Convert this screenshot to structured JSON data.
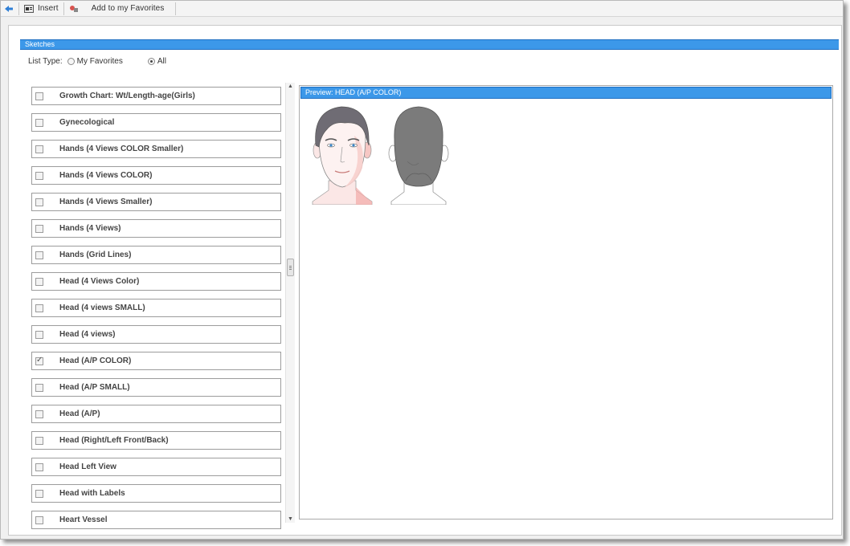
{
  "toolbar": {
    "back_icon": "back-arrow-icon",
    "insert_label": "Insert",
    "favorites_label": "Add to my Favorites"
  },
  "panel": {
    "title": "Sketches"
  },
  "list_type": {
    "label": "List Type:",
    "options": [
      {
        "label": "My Favorites",
        "selected": false
      },
      {
        "label": "All",
        "selected": true
      }
    ]
  },
  "items": [
    {
      "label": "Growth Chart: Wt/Length-age(Girls)",
      "checked": false
    },
    {
      "label": "Gynecological",
      "checked": false
    },
    {
      "label": "Hands (4 Views COLOR Smaller)",
      "checked": false
    },
    {
      "label": "Hands (4 Views COLOR)",
      "checked": false
    },
    {
      "label": "Hands (4 Views Smaller)",
      "checked": false
    },
    {
      "label": "Hands (4 Views)",
      "checked": false
    },
    {
      "label": "Hands (Grid Lines)",
      "checked": false
    },
    {
      "label": "Head (4 Views Color)",
      "checked": false
    },
    {
      "label": "Head (4 views SMALL)",
      "checked": false
    },
    {
      "label": "Head (4 views)",
      "checked": false
    },
    {
      "label": "Head (A/P COLOR)",
      "checked": true
    },
    {
      "label": "Head (A/P SMALL)",
      "checked": false
    },
    {
      "label": "Head (A/P)",
      "checked": false
    },
    {
      "label": "Head (Right/Left Front/Back)",
      "checked": false
    },
    {
      "label": "Head Left View",
      "checked": false
    },
    {
      "label": "Head with Labels",
      "checked": false
    },
    {
      "label": "Heart Vessel",
      "checked": false
    }
  ],
  "preview": {
    "title": "Preview: HEAD (A/P COLOR)"
  },
  "colors": {
    "title_bar": "#3c98e9",
    "hair_front": "#6f6c74",
    "hair_back": "#7b7b7b",
    "skin": "#fbe7e6"
  }
}
